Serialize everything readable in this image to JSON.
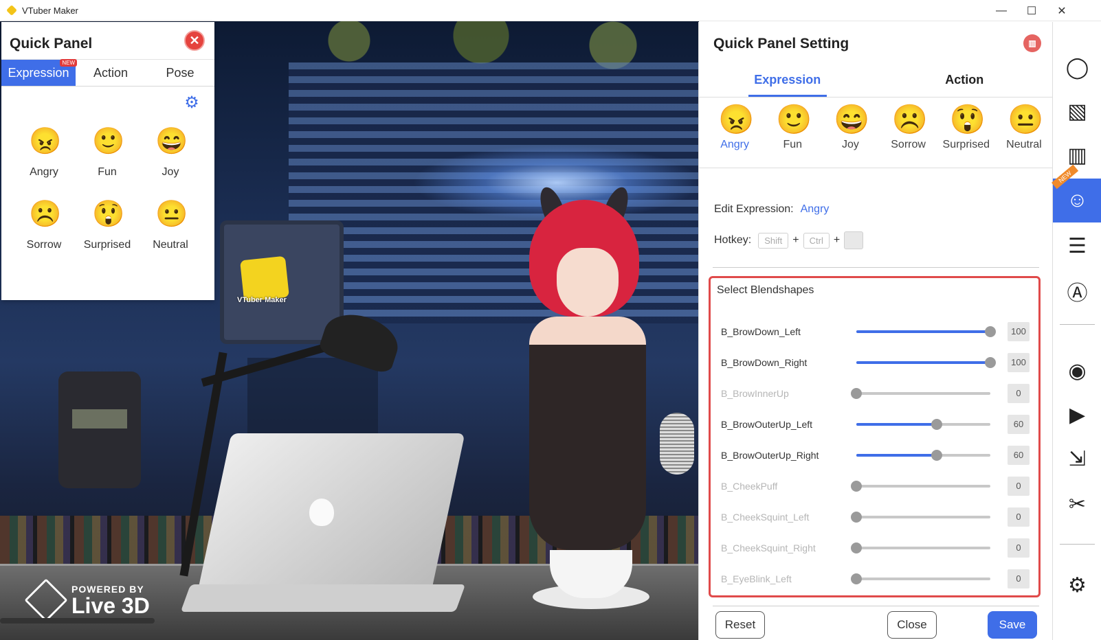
{
  "window": {
    "title": "VTuber Maker",
    "controls": {
      "minimize": "—",
      "maximize": "☐",
      "close": "✕"
    }
  },
  "scene": {
    "watermark_line1": "POWERED BY",
    "watermark_line2": "Live 3D",
    "cube_label": "VTuber Maker"
  },
  "quick_panel": {
    "title": "Quick Panel",
    "tabs": [
      {
        "label": "Expression",
        "badge": "NEW",
        "active": true
      },
      {
        "label": "Action",
        "active": false
      },
      {
        "label": "Pose",
        "active": false
      }
    ],
    "settings_icon": "gear-icon",
    "items": [
      {
        "label": "Angry",
        "emoji": "😠"
      },
      {
        "label": "Fun",
        "emoji": "🙂"
      },
      {
        "label": "Joy",
        "emoji": "😄"
      },
      {
        "label": "Sorrow",
        "emoji": "☹️"
      },
      {
        "label": "Surprised",
        "emoji": "😲"
      },
      {
        "label": "Neutral",
        "emoji": "😐"
      }
    ]
  },
  "settings_panel": {
    "title": "Quick Panel Setting",
    "tabs": [
      {
        "label": "Expression",
        "active": true
      },
      {
        "label": "Action",
        "active": false
      }
    ],
    "expressions": [
      {
        "label": "Angry",
        "emoji": "😠",
        "active": true
      },
      {
        "label": "Fun",
        "emoji": "🙂",
        "active": false
      },
      {
        "label": "Joy",
        "emoji": "😄",
        "active": false
      },
      {
        "label": "Sorrow",
        "emoji": "☹️",
        "active": false
      },
      {
        "label": "Surprised",
        "emoji": "😲",
        "active": false
      },
      {
        "label": "Neutral",
        "emoji": "😐",
        "active": false
      }
    ],
    "edit_expression_label": "Edit Expression:",
    "edit_expression_value": "Angry",
    "hotkey_label": "Hotkey:",
    "hotkey_keys": [
      "Shift",
      "Ctrl",
      ""
    ],
    "hotkey_plus": "+",
    "blendshapes_title": "Select Blendshapes",
    "blendshapes": [
      {
        "name": "B_BrowDown_Left",
        "value": 100
      },
      {
        "name": "B_BrowDown_Right",
        "value": 100
      },
      {
        "name": "B_BrowInnerUp",
        "value": 0
      },
      {
        "name": "B_BrowOuterUp_Left",
        "value": 60
      },
      {
        "name": "B_BrowOuterUp_Right",
        "value": 60
      },
      {
        "name": "B_CheekPuff",
        "value": 0
      },
      {
        "name": "B_CheekSquint_Left",
        "value": 0
      },
      {
        "name": "B_CheekSquint_Right",
        "value": 0
      },
      {
        "name": "B_EyeBlink_Left",
        "value": 0
      }
    ],
    "buttons": {
      "reset": "Reset",
      "close": "Close",
      "save": "Save"
    },
    "accent_color": "#3f6ee8",
    "highlight_color": "#e04a4a"
  },
  "sidebar": {
    "items": [
      {
        "icon": "user-icon",
        "glyph": "◯",
        "active": false
      },
      {
        "icon": "image-icon",
        "glyph": "▧",
        "active": false
      },
      {
        "icon": "chat-panel-icon",
        "glyph": "▥",
        "active": false
      },
      {
        "icon": "face-expression-icon",
        "glyph": "☺",
        "active": true,
        "badge": "NEW"
      },
      {
        "icon": "list-icon",
        "glyph": "☰",
        "active": false
      },
      {
        "icon": "ai-icon",
        "glyph": "Ⓐ",
        "active": false
      },
      {
        "icon": "webcam-icon",
        "glyph": "◉",
        "active": false
      },
      {
        "icon": "tv-icon",
        "glyph": "▶",
        "active": false
      },
      {
        "icon": "minimize-window-icon",
        "glyph": "⇲",
        "active": false
      },
      {
        "icon": "scissors-icon",
        "glyph": "✂",
        "active": false
      },
      {
        "icon": "settings-gear-icon",
        "glyph": "⚙",
        "active": false
      }
    ]
  }
}
